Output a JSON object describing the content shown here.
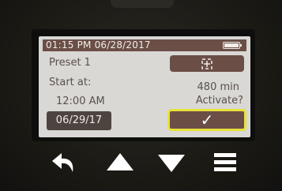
{
  "status_bar": {
    "datetime": "01:15 PM 06/28/2017",
    "battery_icon": "battery-full-icon"
  },
  "preset": {
    "label": "Preset 1"
  },
  "schedule": {
    "start_label": "Start at:",
    "start_time": "12:00 AM",
    "duration": "480 min",
    "activate_prompt": "Activate?",
    "date_button": "06/29/17"
  },
  "buttons": {
    "target_icon": "target-icon",
    "confirm_icon": "checkmark-icon",
    "confirm_glyph": "✓"
  },
  "nav": [
    {
      "icon": "back-arrow-icon"
    },
    {
      "icon": "up-arrow-icon"
    },
    {
      "icon": "down-arrow-icon"
    },
    {
      "icon": "menu-icon"
    }
  ],
  "colors": {
    "accent": "#6b4f47",
    "highlight": "#e8e23a",
    "screen": "#d9d8d4",
    "text": "#5a514c"
  }
}
